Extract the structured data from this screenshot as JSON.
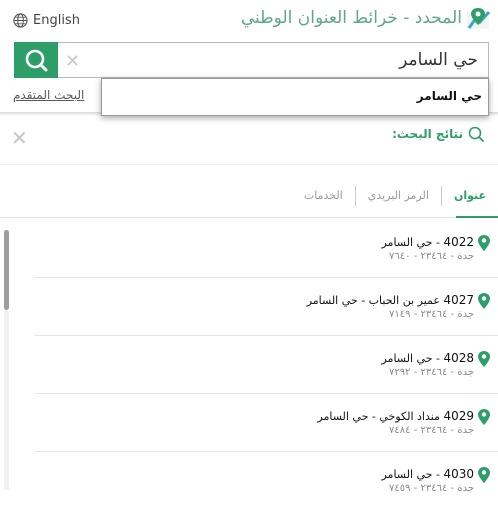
{
  "header": {
    "title": "المحدد - خرائط العنوان الوطني",
    "language_label": "English"
  },
  "search": {
    "value": "حي السامر",
    "advanced_link": "البحث المتقدم",
    "suggestion": "حي السامر"
  },
  "results": {
    "title": "نتائج البحث:",
    "tabs": [
      {
        "label": "عنوان",
        "active": true
      },
      {
        "label": "الرمز البريدي",
        "active": false
      },
      {
        "label": "الخدمات",
        "active": false
      }
    ],
    "items": [
      {
        "number": "4022",
        "street": "",
        "district": "حي السامر",
        "city_line": "جدة - ٢٣٤٦٤ - ٧٦٤٠"
      },
      {
        "number": "4027",
        "street": "عمير بن الحباب",
        "district": "حي السامر",
        "city_line": "جدة - ٢٣٤٦٤ - ٧١٤٩"
      },
      {
        "number": "4028",
        "street": "",
        "district": "حي السامر",
        "city_line": "جدة - ٢٣٤٦٤ - ٧٢٩٢"
      },
      {
        "number": "4029",
        "street": "منداد الكوخي",
        "district": "حي السامر",
        "city_line": "جدة - ٢٣٤٦٤ - ٧٤٨٤"
      },
      {
        "number": "4030",
        "street": "",
        "district": "حي السامر",
        "city_line": "جدة - ٢٣٤٦٤ - ٧٤٥٩"
      }
    ]
  },
  "colors": {
    "accent": "#2e9e69",
    "title": "#5fa68a"
  }
}
